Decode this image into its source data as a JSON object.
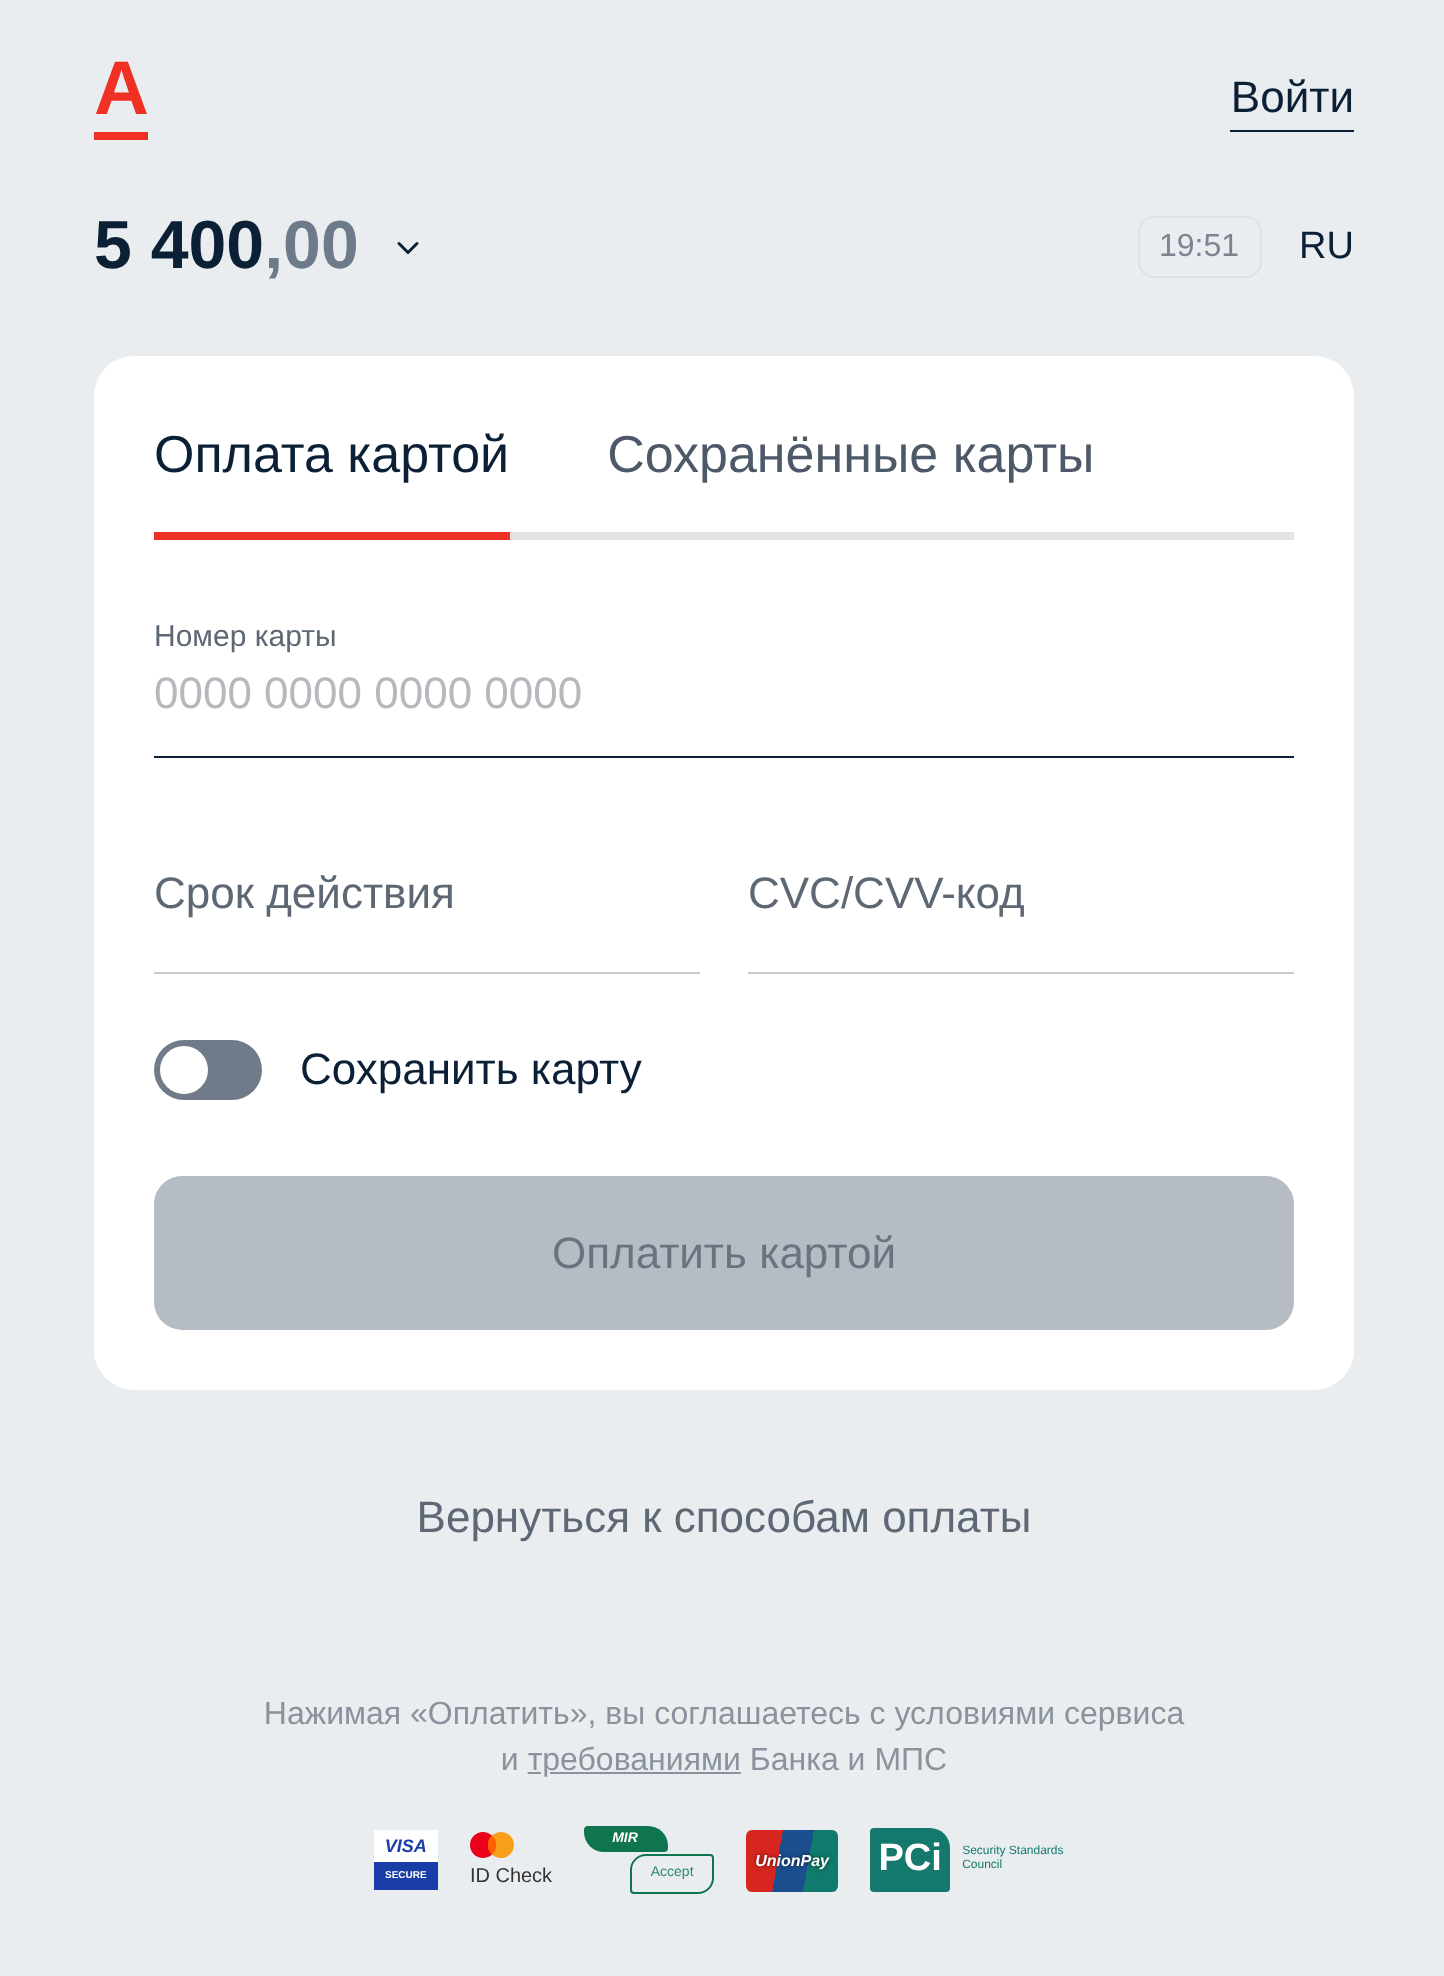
{
  "header": {
    "logo": "А",
    "login": "Войти"
  },
  "summary": {
    "amount": "5 400",
    "amount_fraction": ",00",
    "time": "19:51",
    "language": "RU"
  },
  "payment_card": {
    "tabs": [
      {
        "label": "Оплата картой",
        "selected": true
      },
      {
        "label": "Сохранённые карты",
        "selected": false
      }
    ],
    "card_number": {
      "label": "Номер карты",
      "placeholder": "0000 0000 0000 0000",
      "focused": true
    },
    "expiry": {
      "placeholder": "Срок действия",
      "focused": false
    },
    "cvc": {
      "placeholder": "CVC/CVV-код",
      "focused": false
    },
    "save_card": {
      "label": "Сохранить карту",
      "on": false
    },
    "pay_button": {
      "label": "Оплатить картой",
      "disabled": true
    }
  },
  "back_link": "Вернуться к способам оплаты",
  "footer": {
    "consent": {
      "line_1": "Нажимая «Оплатить», вы соглашаетесь с условиями сервиса",
      "line_2_start": "и",
      "link": "требованиями",
      "line_2_end": "Банка и МПС"
    },
    "badges": [
      {
        "kind": "visa_secure",
        "texts": [
          "VISA",
          "SECURE"
        ]
      },
      {
        "kind": "mastercard_id_check",
        "texts": [
          "ID Check"
        ]
      },
      {
        "kind": "mir_accept",
        "texts": [
          "MIR",
          "Accept"
        ]
      },
      {
        "kind": "unionpay",
        "texts": [
          "UnionPay"
        ]
      },
      {
        "kind": "pci",
        "texts": [
          "PCi",
          "Security Standards Council"
        ]
      }
    ]
  }
}
